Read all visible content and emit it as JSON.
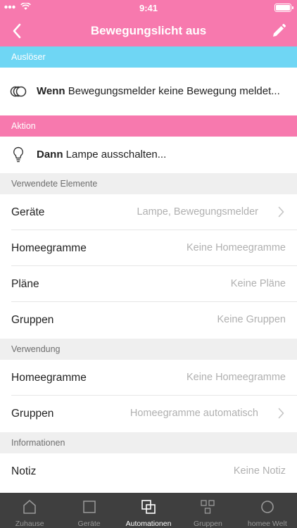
{
  "status_bar": {
    "time": "9:41"
  },
  "nav": {
    "title": "Bewegungslicht aus"
  },
  "trigger": {
    "section_label": "Auslöser",
    "keyword": "Wenn",
    "text": " Bewegungsmelder keine Bewegung meldet..."
  },
  "action": {
    "section_label": "Aktion",
    "keyword": "Dann",
    "text": " Lampe ausschalten..."
  },
  "used_elements": {
    "section_label": "Verwendete Elemente",
    "rows": [
      {
        "label": "Geräte",
        "value": "Lampe, Bewegungsmelder"
      },
      {
        "label": "Homeegramme",
        "value": "Keine Homeegramme"
      },
      {
        "label": "Pläne",
        "value": "Keine Pläne"
      },
      {
        "label": "Gruppen",
        "value": "Keine Gruppen"
      }
    ]
  },
  "usage": {
    "section_label": "Verwendung",
    "rows": [
      {
        "label": "Homeegramme",
        "value": "Keine Homeegramme"
      },
      {
        "label": "Gruppen",
        "value": "Homeegramme automatisch"
      }
    ]
  },
  "info": {
    "section_label": "Informationen",
    "rows": [
      {
        "label": "Notiz",
        "value": "Keine Notiz"
      }
    ]
  },
  "tabs": [
    {
      "label": "Zuhause",
      "icon": "house-icon"
    },
    {
      "label": "Geräte",
      "icon": "square-icon"
    },
    {
      "label": "Automationen",
      "icon": "overlapping-squares-icon",
      "active": true
    },
    {
      "label": "Gruppen",
      "icon": "grid-squares-icon"
    },
    {
      "label": "homee Welt",
      "icon": "circle-icon"
    }
  ],
  "colors": {
    "primary_pink": "#f779ae",
    "trigger_blue": "#6fd6f4",
    "tab_bar": "#3f3f3f"
  }
}
